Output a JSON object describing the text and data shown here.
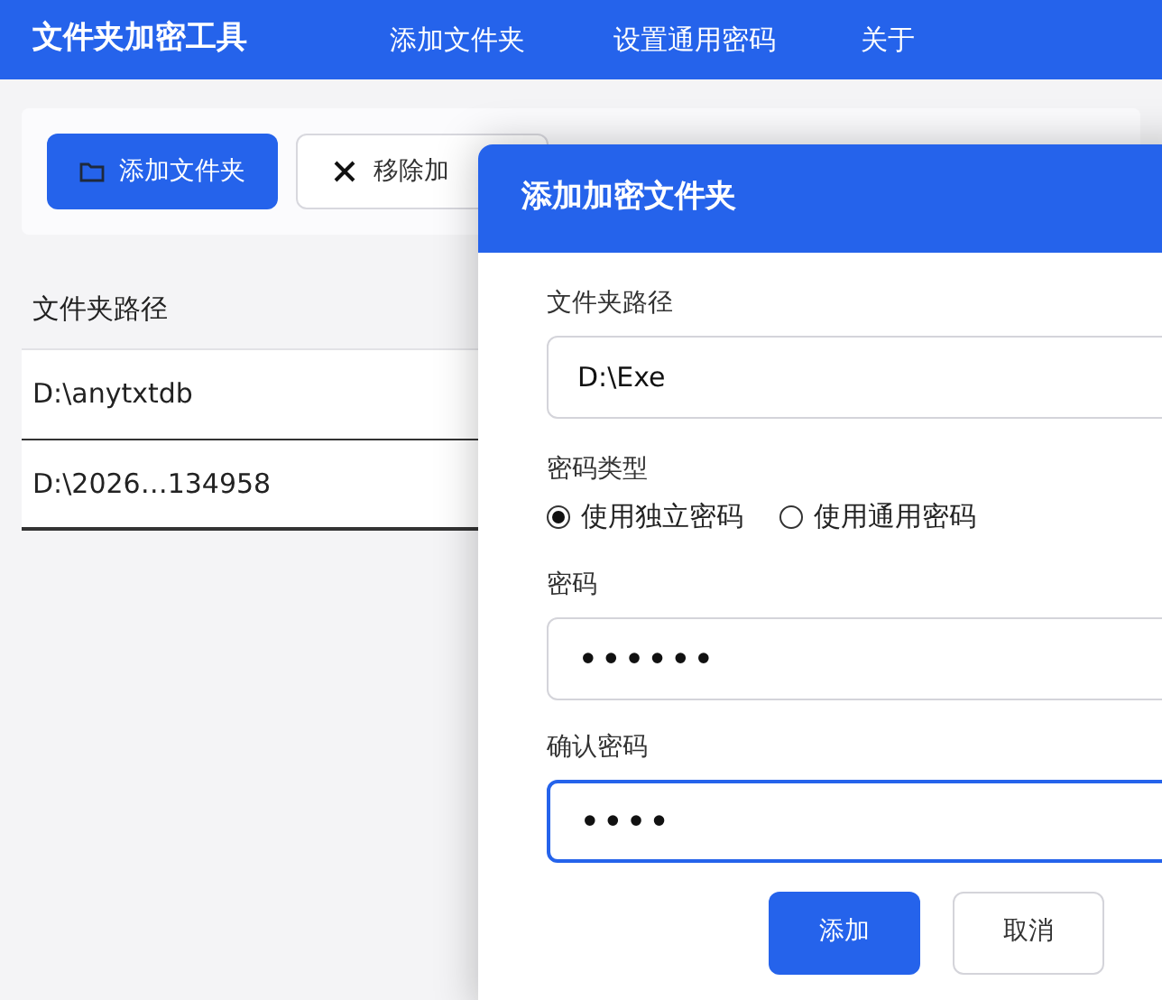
{
  "app": {
    "title": "文件夹加密工具"
  },
  "nav": [
    {
      "label": "添加文件夹"
    },
    {
      "label": "设置通用密码"
    },
    {
      "label": "关于"
    }
  ],
  "toolbar": [
    {
      "label": "添加文件夹",
      "kind": "primary"
    },
    {
      "label": "移除加",
      "kind": "remove"
    }
  ],
  "table": {
    "columns": [
      "文件夹路径"
    ],
    "rows": [
      "D:\\anytxtdb",
      "D:\\2026…134958"
    ]
  },
  "dialog": {
    "title": "添加加密文件夹",
    "path": {
      "label": "文件夹路径",
      "value": "D:\\Exe",
      "focused": false
    },
    "password_type": {
      "label": "密码类型",
      "options": [
        {
          "label": "使用独立密码",
          "selected": true
        },
        {
          "label": "使用通用密码",
          "selected": false
        }
      ]
    },
    "password": {
      "label": "密码",
      "value": "••••••",
      "focused": false
    },
    "confirm": {
      "label": "确认密码",
      "value": "••••",
      "focused": true
    },
    "buttons": [
      {
        "label": "添加",
        "kind": "primary"
      },
      {
        "label": "取消",
        "kind": "secondary"
      }
    ]
  }
}
